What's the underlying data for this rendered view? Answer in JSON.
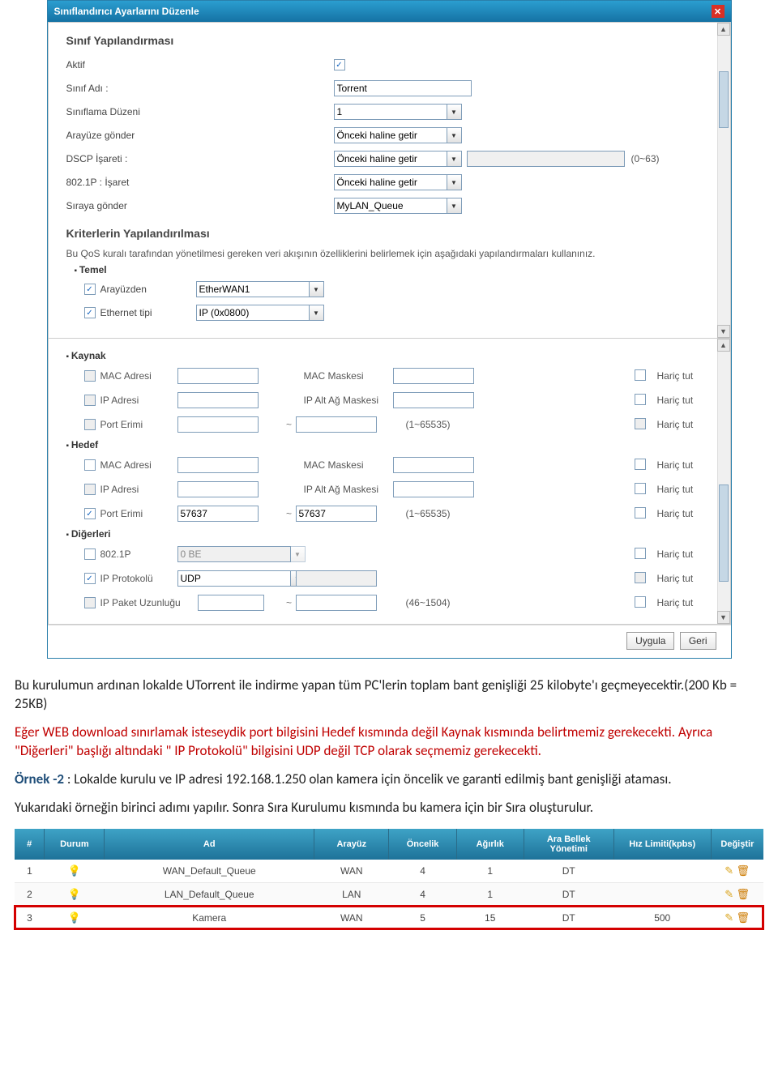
{
  "dialog": {
    "title": "Sınıflandırıcı Ayarlarını Düzenle",
    "section1": "Sınıf Yapılandırması",
    "active_label": "Aktif",
    "class_name_label": "Sınıf Adı :",
    "class_name_value": "Torrent",
    "class_order_label": "Sınıflama Düzeni",
    "class_order_value": "1",
    "send_iface_label": "Arayüze gönder",
    "send_iface_value": "Önceki haline getir",
    "dscp_label": "DSCP İşareti :",
    "dscp_value": "Önceki haline getir",
    "dscp_range": "(0~63)",
    "sign_8021p_label": "802.1P : İşaret",
    "sign_8021p_value": "Önceki haline getir",
    "queue_label": "Sıraya gönder",
    "queue_value": "MyLAN_Queue",
    "section2": "Kriterlerin Yapılandırılması",
    "section2_desc": "Bu QoS kuralı tarafından yönetilmesi gereken veri akışının özelliklerini belirlemek için aşağıdaki yapılandırmaları kullanınız.",
    "basic_h": "Temel",
    "from_iface_label": "Arayüzden",
    "from_iface_value": "EtherWAN1",
    "eth_type_label": "Ethernet tipi",
    "eth_type_value": "IP (0x0800)",
    "src_h": "Kaynak",
    "dst_h": "Hedef",
    "other_h": "Diğerleri",
    "mac_label": "MAC Adresi",
    "mac_mask_label": "MAC Maskesi",
    "ip_label": "IP Adresi",
    "subnet_label": "IP Alt Ağ Maskesi",
    "port_label": "Port Erimi",
    "port_range_hint": "(1~65535)",
    "exclude_label": "Hariç tut",
    "dst_port_from": "57637",
    "dst_port_to": "57637",
    "o_8021p_label": "802.1P",
    "o_8021p_value": "0 BE",
    "o_ipproto_label": "IP Protokolü",
    "o_ipproto_value": "UDP",
    "o_pktlen_label": "IP Paket Uzunluğu",
    "o_pktlen_hint": "(46~1504)",
    "btn_apply": "Uygula",
    "btn_back": "Geri"
  },
  "doc": {
    "p1": "Bu kurulumun ardınan lokalde UTorrent ile indirme yapan tüm PC'lerin toplam bant genişliği 25 kilobyte'ı geçmeyecektir.(200 Kb = 25KB)",
    "p2": "Eğer WEB download sınırlamak isteseydik port bilgisini Hedef kısmında değil Kaynak kısmında belirtmemiz gerekecekti. Ayrıca \"Diğerleri\" başlığı altındaki \" IP Protokolü\" bilgisini UDP değil TCP olarak seçmemiz gerekecekti.",
    "p3a": "Örnek -2",
    "p3b": " : Lokalde kurulu ve IP adresi 192.168.1.250 olan kamera için öncelik ve garanti edilmiş bant genişliği ataması.",
    "p4": "Yukarıdaki örneğin birinci adımı yapılır. Sonra Sıra Kurulumu kısmında bu kamera için bir Sıra oluşturulur."
  },
  "qtable": {
    "headers": [
      "#",
      "Durum",
      "Ad",
      "Arayüz",
      "Öncelik",
      "Ağırlık",
      "Ara Bellek Yönetimi",
      "Hız Limiti(kpbs)",
      "Değiştir"
    ],
    "rows": [
      {
        "n": "1",
        "name": "WAN_Default_Queue",
        "iface": "WAN",
        "pri": "4",
        "wt": "1",
        "buf": "DT",
        "rate": ""
      },
      {
        "n": "2",
        "name": "LAN_Default_Queue",
        "iface": "LAN",
        "pri": "4",
        "wt": "1",
        "buf": "DT",
        "rate": ""
      },
      {
        "n": "3",
        "name": "Kamera",
        "iface": "WAN",
        "pri": "5",
        "wt": "15",
        "buf": "DT",
        "rate": "500"
      }
    ]
  }
}
